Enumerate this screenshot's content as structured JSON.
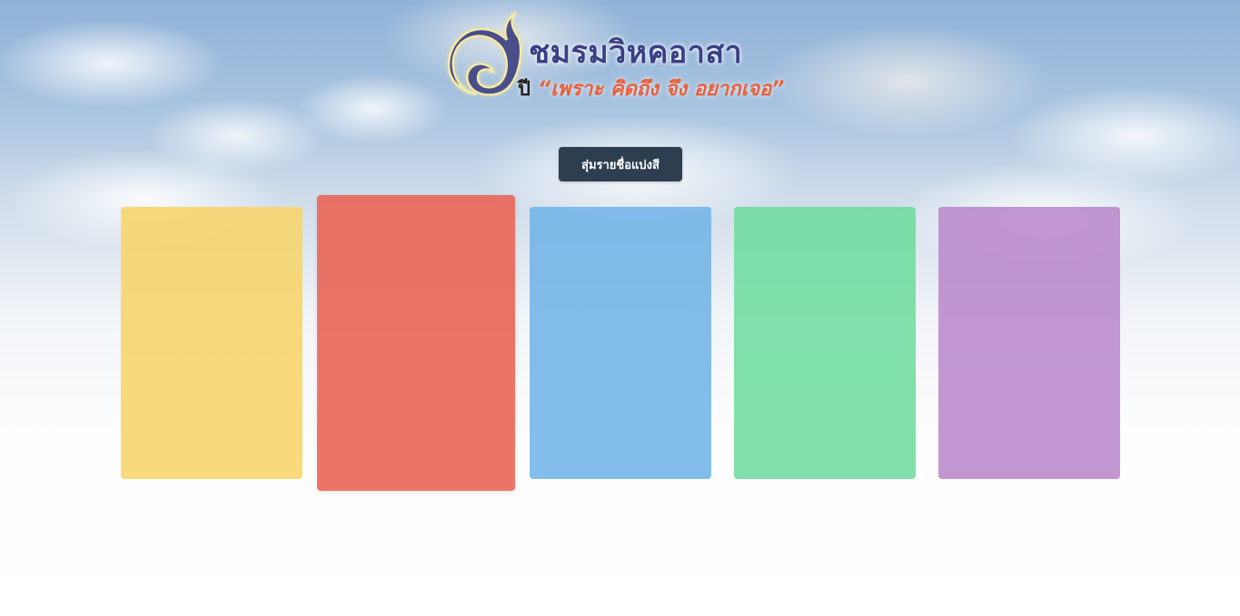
{
  "header": {
    "logo_icon": "thai-numeral-eight-logo",
    "club_name": "ชมรมวิหคอาสา",
    "year_prefix": "ปี",
    "slogan": "“เพราะ คิดถึง จึง อยากเจอ”"
  },
  "actions": {
    "shuffle_label": "สุ่มรายชื่อแบ่งสี"
  },
  "color_groups": [
    {
      "color": "#f7d56a",
      "name": "yellow"
    },
    {
      "color": "#ea6253",
      "name": "red",
      "selected": true
    },
    {
      "color": "#72b4e6",
      "name": "blue"
    },
    {
      "color": "#6fdc9e",
      "name": "green"
    },
    {
      "color": "#b989cb",
      "name": "purple"
    }
  ],
  "colors": {
    "button_bg": "#2c3e50",
    "title": "#3b3f86",
    "slogan": "#e8603c"
  }
}
